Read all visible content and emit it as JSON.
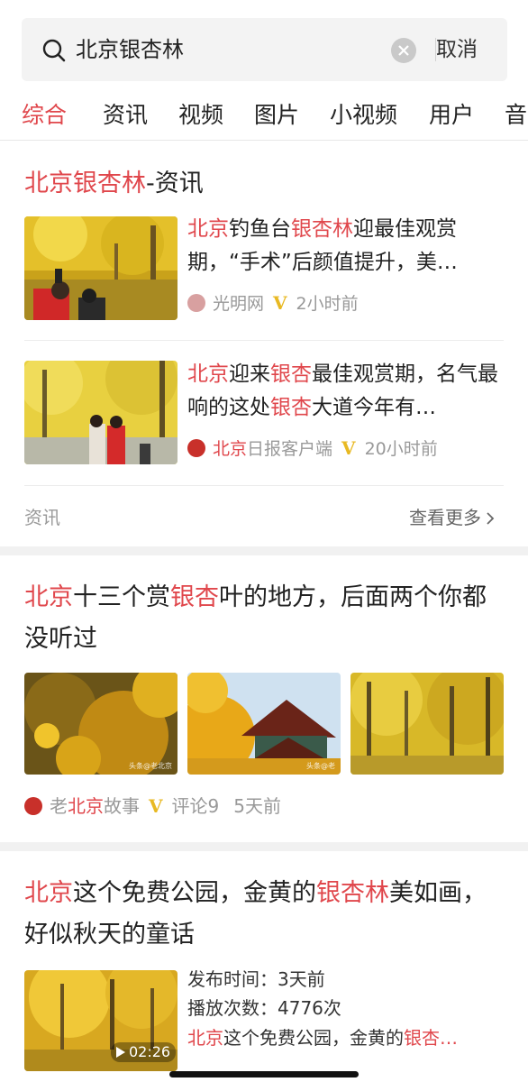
{
  "search": {
    "query": "北京银杏林",
    "cancel_label": "取消"
  },
  "tabs": [
    "综合",
    "资讯",
    "视频",
    "图片",
    "小视频",
    "用户",
    "音"
  ],
  "news_section": {
    "title_hl": "北京银杏林",
    "title_rest": "-资讯",
    "items": [
      {
        "title_parts": [
          {
            "t": "北京",
            "hl": true
          },
          {
            "t": "钓鱼台",
            "hl": false
          },
          {
            "t": "银杏林",
            "hl": true
          },
          {
            "t": "迎最佳观赏期，“手术”后颜值提升，美…",
            "hl": false
          }
        ],
        "source_hl": "",
        "source": "光明网",
        "time": "2小时前",
        "logo_color": "#d8a0a0"
      },
      {
        "title_parts": [
          {
            "t": "北京",
            "hl": true
          },
          {
            "t": "迎来",
            "hl": false
          },
          {
            "t": "银杏",
            "hl": true
          },
          {
            "t": "最佳观赏期，名气最响的这处",
            "hl": false
          },
          {
            "t": "银杏",
            "hl": true
          },
          {
            "t": "大道今年有…",
            "hl": false
          }
        ],
        "source_hl": "北京",
        "source": "日报客户端",
        "time": "20小时前",
        "logo_color": "#c8302a"
      }
    ],
    "footer_left": "资讯",
    "footer_right": "查看更多"
  },
  "article2": {
    "title_parts": [
      {
        "t": "北京",
        "hl": true
      },
      {
        "t": "十三个赏",
        "hl": false
      },
      {
        "t": "银杏",
        "hl": true
      },
      {
        "t": "叶的地方，后面两个你都没听过",
        "hl": false
      }
    ],
    "source_pre": "老",
    "source_hl": "北京",
    "source_post": "故事",
    "comments": "评论9",
    "time": "5天前",
    "watermarks": [
      "头条@老北京",
      "头条@老",
      ""
    ]
  },
  "article3": {
    "title_parts": [
      {
        "t": "北京",
        "hl": true
      },
      {
        "t": "这个免费公园，金黄的",
        "hl": false
      },
      {
        "t": "银杏林",
        "hl": true
      },
      {
        "t": "美如画，好似秋天的童话",
        "hl": false
      }
    ],
    "publish_time": "发布时间：3天前",
    "play_count": "播放次数：4776次",
    "desc_parts": [
      {
        "t": "北京",
        "hl": true
      },
      {
        "t": "这个免费公园，金黄的",
        "hl": false
      },
      {
        "t": "银杏…",
        "hl": true
      }
    ],
    "duration": "02:26"
  },
  "colors": {
    "accent": "#e0474c",
    "verified": "#e8b923",
    "muted": "#999999"
  }
}
